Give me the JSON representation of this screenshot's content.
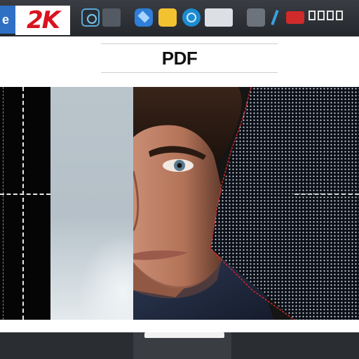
{
  "taskbar": {
    "edge_letter": "e",
    "brand_label": "2K",
    "icons": [
      {
        "name": "edge-browser-icon"
      },
      {
        "name": "brand-2k-icon"
      },
      {
        "name": "camera-app-icon"
      },
      {
        "name": "grey-window-icon"
      },
      {
        "name": "blue-diamond-app-icon"
      },
      {
        "name": "yellow-app-icon"
      },
      {
        "name": "blue-circle-app-icon"
      },
      {
        "name": "window-thumbnail-icon"
      },
      {
        "name": "photos-app-icon"
      },
      {
        "name": "pen-icon"
      },
      {
        "name": "red-app-icon"
      },
      {
        "name": "windows-group-icon"
      }
    ],
    "colors": {
      "brand_red": "#d9141f",
      "edge_blue": "#2f6fc4"
    }
  },
  "document": {
    "title": "PDF"
  },
  "image_panel": {
    "description_icon": "portrait-photo"
  }
}
